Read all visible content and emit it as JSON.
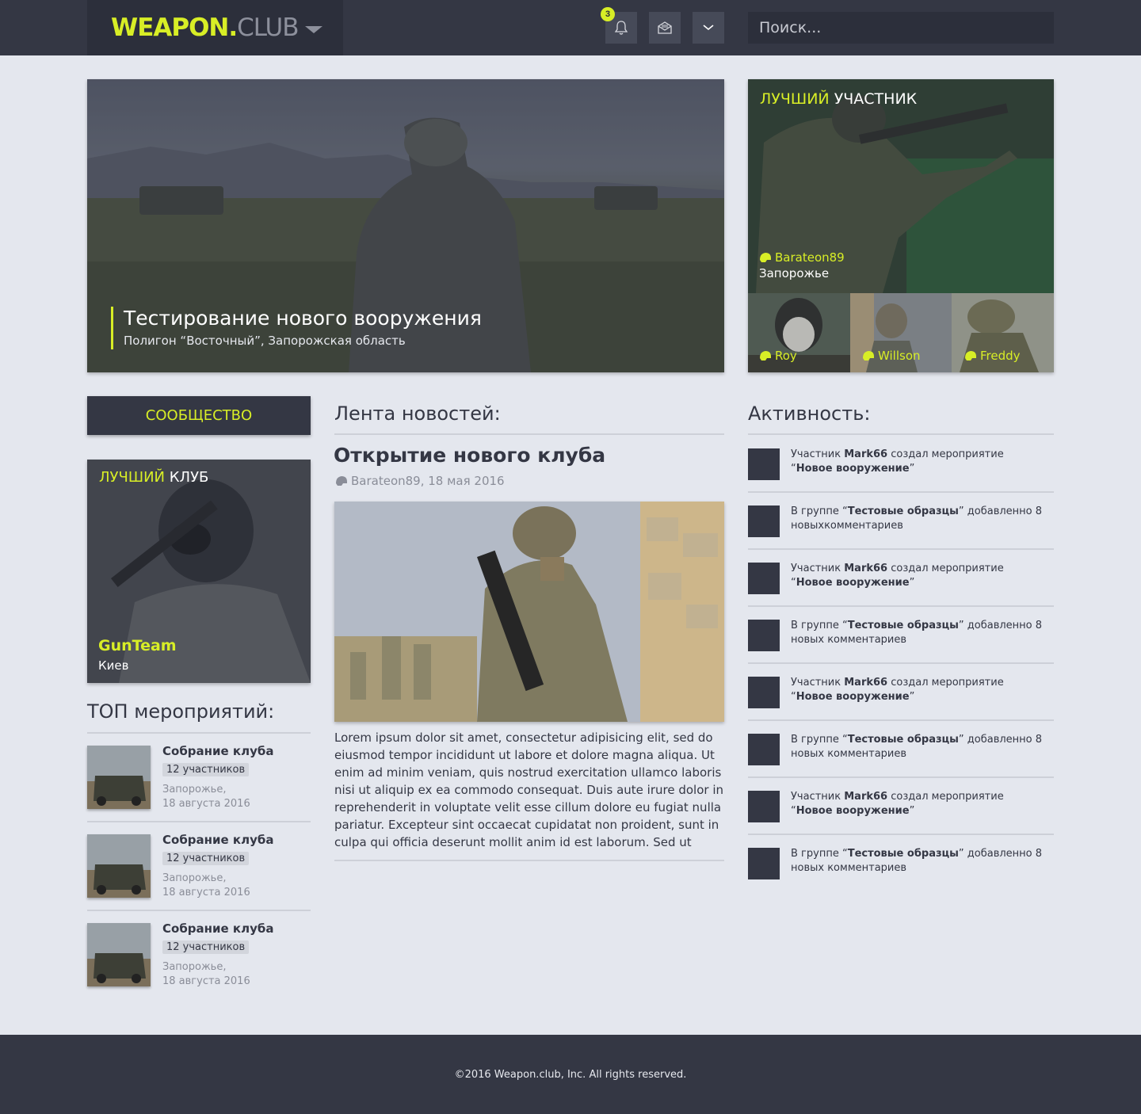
{
  "header": {
    "logo_strong": "WEAPON.",
    "logo_light": "CLUB",
    "notifications_count": "3",
    "search_placeholder": "Поиск..."
  },
  "hero": {
    "title": "Тестирование нового вооружения",
    "subtitle": "Полигон “Восточный”, Запорожская область"
  },
  "best_member": {
    "title_accent": "ЛУЧШИЙ",
    "title_rest": "УЧАСТНИК",
    "name": "Barateon89",
    "city": "Запорожье",
    "others": [
      {
        "name": "Roy"
      },
      {
        "name": "Willson"
      },
      {
        "name": "Freddy"
      }
    ]
  },
  "community_button": "СООБЩЕСТВО",
  "best_club": {
    "title_accent": "ЛУЧШИЙ",
    "title_rest": "КЛУБ",
    "name": "GunTeam",
    "city": "Киев"
  },
  "top_events": {
    "heading": "ТОП мероприятий:",
    "items": [
      {
        "title": "Собрание клуба",
        "participants": "12 участников",
        "place": "Запорожье,",
        "date": "18 августа 2016"
      },
      {
        "title": "Собрание клуба",
        "participants": "12 участников",
        "place": "Запорожье,",
        "date": "18 августа 2016"
      },
      {
        "title": "Собрание клуба",
        "participants": "12 участников",
        "place": "Запорожье,",
        "date": "18 августа 2016"
      }
    ]
  },
  "news": {
    "heading": "Лента новостей:",
    "article": {
      "title": "Открытие нового клуба",
      "meta": "Barateon89, 18 мая 2016",
      "text": "Lorem ipsum dolor sit amet, consectetur adipisicing elit, sed do eiusmod tempor incididunt ut labore et dolore magna aliqua. Ut enim ad minim veniam, quis nostrud exercitation ullamco laboris nisi ut aliquip ex ea commodo consequat. Duis aute irure dolor in reprehenderit in voluptate velit esse cillum dolore eu fugiat nulla pariatur. Excepteur sint occaecat cupidatat non proident, sunt in culpa qui officia deserunt mollit anim id est laborum. Sed ut"
    }
  },
  "activity": {
    "heading": "Активность:",
    "items": [
      {
        "type": "event",
        "p1": "Участник ",
        "b1": "Mark66",
        "p2": " создал мероприятие",
        "p3": "“",
        "b2": "Новое вооружение",
        "p4": "”"
      },
      {
        "type": "comments",
        "p1": "В группе “",
        "b1": "Тестовые образцы",
        "p2": "” добавленно 8",
        "p3": "новыхкомментариев",
        "b2": "",
        "p4": ""
      },
      {
        "type": "event",
        "p1": "Участник ",
        "b1": "Mark66",
        "p2": " создал мероприятие",
        "p3": "“",
        "b2": "Новое вооружение",
        "p4": "”"
      },
      {
        "type": "comments",
        "p1": "В группе “",
        "b1": "Тестовые образцы",
        "p2": "” добавленно 8",
        "p3": "новых комментариев",
        "b2": "",
        "p4": ""
      },
      {
        "type": "event",
        "p1": "Участник ",
        "b1": "Mark66",
        "p2": " создал мероприятие",
        "p3": "“",
        "b2": "Новое вооружение",
        "p4": "”"
      },
      {
        "type": "comments",
        "p1": "В группе “",
        "b1": "Тестовые образцы",
        "p2": "” добавленно 8",
        "p3": "новых комментариев",
        "b2": "",
        "p4": ""
      },
      {
        "type": "event",
        "p1": "Участник ",
        "b1": "Mark66",
        "p2": " создал мероприятие",
        "p3": "“",
        "b2": "Новое вооружение",
        "p4": "”"
      },
      {
        "type": "comments",
        "p1": "В группе “",
        "b1": "Тестовые образцы",
        "p2": "” добавленно 8",
        "p3": "новых комментариев",
        "b2": "",
        "p4": ""
      }
    ]
  },
  "footer": {
    "copyright": "©2016 Weapon.club, Inc. All rights reserved."
  },
  "colors": {
    "accent": "#d8ee26",
    "dark": "#343744",
    "background": "#e4e7ee"
  },
  "icons": {
    "header": [
      "bell-icon",
      "mail-icon",
      "chevron-down-icon"
    ],
    "user": "helmet-icon"
  }
}
